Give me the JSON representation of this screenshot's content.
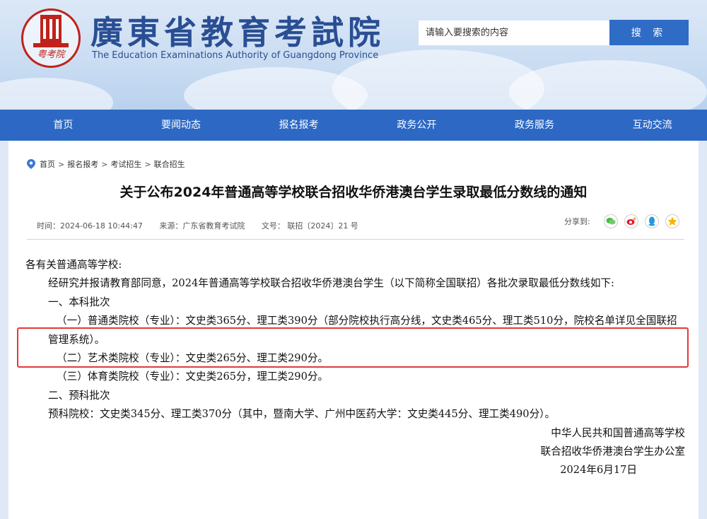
{
  "header": {
    "title": "廣東省教育考試院",
    "title_en": "The Education Examinations Authority of Guangdong Province",
    "seal_text": "粤考院",
    "search_placeholder": "请输入要搜索的内容",
    "search_button": "搜 索"
  },
  "nav": {
    "items": [
      "首页",
      "要闻动态",
      "报名报考",
      "政务公开",
      "政务服务",
      "互动交流"
    ]
  },
  "breadcrumb": [
    "首页",
    "报名报考",
    "考试招生",
    "联合招生"
  ],
  "article": {
    "title": "关于公布2024年普通高等学校联合招收华侨港澳台学生录取最低分数线的通知",
    "time": "时间：2024-06-18 10:44:47",
    "source": "来源：广东省教育考试院",
    "doc_no": "文号： 联招〔2024〕21 号",
    "share_label": "分享到:",
    "paragraphs": {
      "salutation": "各有关普通高等学校:",
      "intro": "经研究并报请教育部同意，2024年普通高等学校联合招收华侨港澳台学生（以下简称全国联招）各批次录取最低分数线如下:",
      "sec1": "一、本科批次",
      "item1": "（一）普通类院校（专业）：文史类365分、理工类390分（部分院校执行高分线，文史类465分、理工类510分，院校名单详见全国联招管理系统）。",
      "item2": "（二）艺术类院校（专业）：文史类265分、理工类290分。",
      "item3": "（三）体育类院校（专业）：文史类265分，理工类290分。",
      "sec2": "二、预科批次",
      "item4": "预科院校：文史类345分、理工类370分（其中，暨南大学、广州中医药大学：文史类445分、理工类490分）。",
      "sign1": "中华人民共和国普通高等学校",
      "sign2": "联合招收华侨港澳台学生办公室",
      "date": "2024年6月17日"
    }
  },
  "colors": {
    "nav_bg": "#2d69c4",
    "brand_blue": "#2a4e93",
    "highlight_red": "#e5383b"
  },
  "icons": {
    "share": [
      "wechat-icon",
      "weibo-icon",
      "qq-icon",
      "qzone-icon"
    ]
  }
}
